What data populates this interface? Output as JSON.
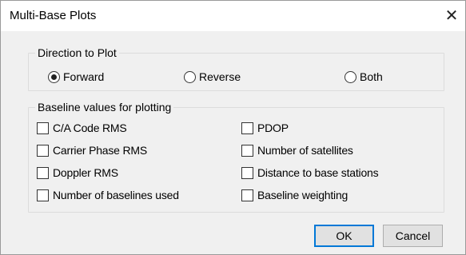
{
  "window": {
    "title": "Multi-Base Plots",
    "close_glyph": "✕"
  },
  "direction": {
    "legend": "Direction to Plot",
    "options": [
      {
        "label": "Forward",
        "selected": true
      },
      {
        "label": "Reverse",
        "selected": false
      },
      {
        "label": "Both",
        "selected": false
      }
    ]
  },
  "baseline": {
    "legend": "Baseline values for plotting",
    "left_items": [
      {
        "label": "C/A Code RMS",
        "checked": false
      },
      {
        "label": "Carrier Phase RMS",
        "checked": false
      },
      {
        "label": "Doppler RMS",
        "checked": false
      },
      {
        "label": "Number of baselines used",
        "checked": false
      }
    ],
    "right_items": [
      {
        "label": "PDOP",
        "checked": false
      },
      {
        "label": "Number of satellites",
        "checked": false
      },
      {
        "label": "Distance to base stations",
        "checked": false
      },
      {
        "label": "Baseline weighting",
        "checked": false
      }
    ]
  },
  "buttons": {
    "ok": "OK",
    "cancel": "Cancel"
  }
}
